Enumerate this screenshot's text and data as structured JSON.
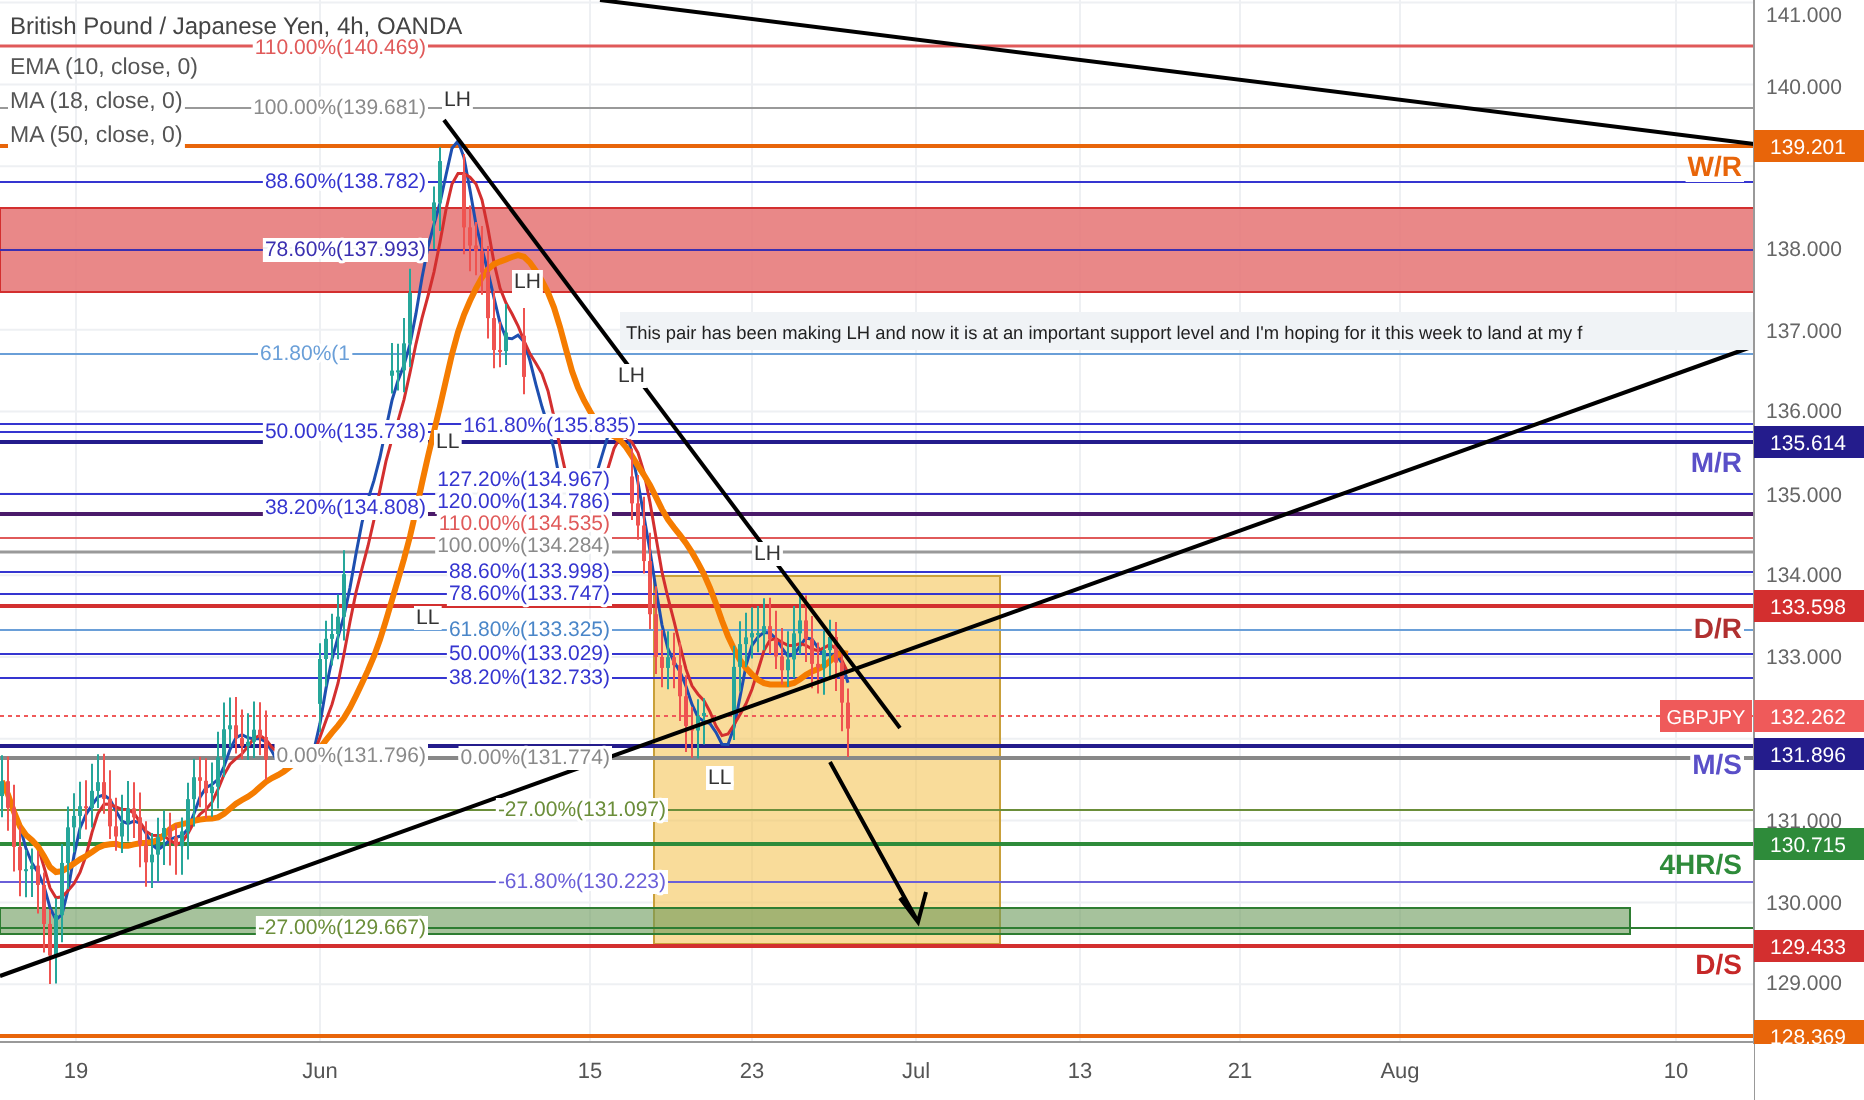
{
  "chart": {
    "title": "British Pound / Japanese Yen, 4h, OANDA",
    "indicators": [
      "EMA (10, close, 0)",
      "MA (18, close, 0)",
      "MA (50, close, 0)"
    ],
    "fib_labels": [
      {
        "text": "110.00%(140.469)",
        "color": "#e05a5a"
      },
      {
        "text": "100.00%(139.681)",
        "color": "#8a8a8a"
      },
      {
        "text": "88.60%(138.782)",
        "color": "#3535d0"
      },
      {
        "text": "78.60%(137.993)",
        "color": "#3a2fb0"
      },
      {
        "text": "61.80%(1",
        "color": "#6a9fd8"
      },
      {
        "text": "50.00%(135.738)",
        "color": "#3535d0"
      },
      {
        "text": "38.20%(134.808)",
        "color": "#3535d0"
      },
      {
        "text": "0.00%(131.796)",
        "color": "#8a8a8a"
      },
      {
        "text": "161.80%(135.835)",
        "color": "#3535d0"
      },
      {
        "text": "127.20%(134.967)",
        "color": "#3535d0"
      },
      {
        "text": "120.00%(134.786)",
        "color": "#3535d0"
      },
      {
        "text": "110.00%(134.535)",
        "color": "#e05a5a"
      },
      {
        "text": "100.00%(134.284)",
        "color": "#8a8a8a"
      },
      {
        "text": "88.60%(133.998)",
        "color": "#3535d0"
      },
      {
        "text": "78.60%(133.747)",
        "color": "#3535d0"
      },
      {
        "text": "61.80%(133.325)",
        "color": "#4a86c8"
      },
      {
        "text": "50.00%(133.029)",
        "color": "#3535d0"
      },
      {
        "text": "38.20%(132.733)",
        "color": "#3535d0"
      },
      {
        "text": "0.00%(131.774)",
        "color": "#8a8a8a"
      },
      {
        "text": "-27.00%(131.097)",
        "color": "#6b8e3a"
      },
      {
        "text": "-61.80%(130.223)",
        "color": "#6a5fd8"
      },
      {
        "text": "-27.00%(129.667)",
        "color": "#6b8e3a"
      }
    ],
    "pattern_labels": [
      "LH",
      "LH",
      "LH",
      "LL",
      "LL",
      "LH",
      "LL"
    ],
    "note": "This pair has been making LH and now it is at an important support level and I'm hoping for it this week to land at my f",
    "zone_labels": [
      {
        "text": "W/R",
        "color": "#e8650a"
      },
      {
        "text": "M/R",
        "color": "#5a4fc8"
      },
      {
        "text": "D/R",
        "color": "#b03030"
      },
      {
        "text": "M/S",
        "color": "#5a4fc8"
      },
      {
        "text": "4HR/S",
        "color": "#2e8b3a"
      },
      {
        "text": "D/S",
        "color": "#c62828"
      }
    ],
    "price_tags": [
      {
        "text": "139.201",
        "color": "#e8650a"
      },
      {
        "text": "135.614",
        "color": "#241c8c"
      },
      {
        "text": "133.598",
        "color": "#d32f2f"
      },
      {
        "symbol": "GBPJPY",
        "text": "132.262",
        "color": "#ef5a5a"
      },
      {
        "text": "131.896",
        "color": "#241c8c"
      },
      {
        "text": "130.715",
        "color": "#2e8b3a"
      },
      {
        "text": "129.433",
        "color": "#d32f2f"
      },
      {
        "text": "128.369",
        "color": "#e8650a"
      }
    ],
    "price_axis": [
      "141.000",
      "140.000",
      "138.000",
      "137.000",
      "136.000",
      "135.000",
      "134.000",
      "133.000",
      "131.000",
      "130.000",
      "129.000"
    ],
    "time_axis": [
      "19",
      "Jun",
      "15",
      "23",
      "Jul",
      "13",
      "21",
      "Aug",
      "10"
    ]
  }
}
